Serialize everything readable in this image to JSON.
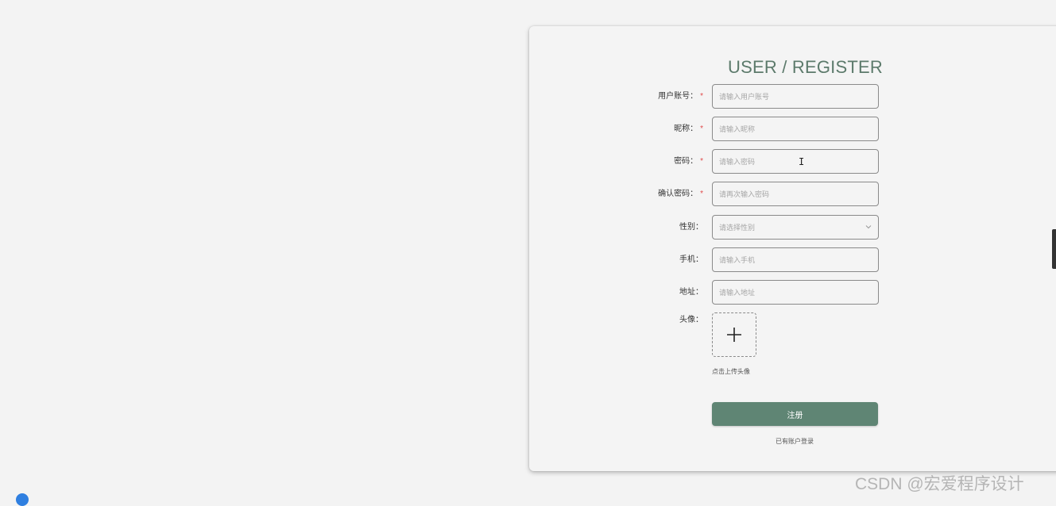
{
  "form": {
    "title": "USER / REGISTER",
    "fields": [
      {
        "label": "用户账号",
        "required": true,
        "placeholder": "请输入用户账号"
      },
      {
        "label": "昵称",
        "required": true,
        "placeholder": "请输入昵称"
      },
      {
        "label": "密码",
        "required": true,
        "placeholder": "请输入密码"
      },
      {
        "label": "确认密码",
        "required": true,
        "placeholder": "请再次输入密码"
      },
      {
        "label": "性别",
        "required": false,
        "placeholder": "请选择性别"
      },
      {
        "label": "手机",
        "required": false,
        "placeholder": "请输入手机"
      },
      {
        "label": "地址",
        "required": false,
        "placeholder": "请输入地址"
      }
    ],
    "avatar_label": "头像",
    "colon": "：",
    "required_mark": "*",
    "upload_hint": "点击上传头像",
    "submit_label": "注册",
    "login_link": "已有账户登录"
  },
  "watermark": "CSDN @宏爱程序设计",
  "colors": {
    "accent": "#5f8574",
    "title": "#5c7a6b",
    "required": "#e04a4a",
    "background": "#f3f3f3"
  },
  "icons": {
    "select": "chevron-down-icon",
    "upload": "plus-icon",
    "cursor": "text-cursor-icon"
  }
}
